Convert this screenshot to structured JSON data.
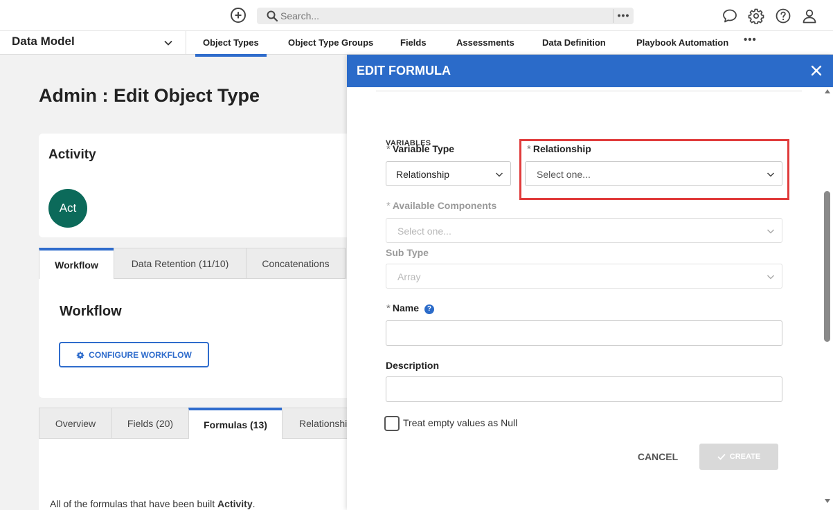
{
  "topbar": {
    "search_placeholder": "Search...",
    "search_more": "•••"
  },
  "nav": {
    "model": "Data Model",
    "tabs": [
      {
        "label": "Object Types",
        "active": true
      },
      {
        "label": "Object Type Groups"
      },
      {
        "label": "Fields"
      },
      {
        "label": "Assessments"
      },
      {
        "label": "Data Definition"
      },
      {
        "label": "Playbook Automation"
      }
    ],
    "more": "•••"
  },
  "page": {
    "title": "Admin : Edit Object Type",
    "object_name": "Activity",
    "avatar_text": "Act",
    "upper_tabs": [
      {
        "label": "Workflow",
        "active": true
      },
      {
        "label": "Data Retention (11/10)"
      },
      {
        "label": "Concatenations"
      }
    ],
    "workflow_title": "Workflow",
    "configure_button": "CONFIGURE WORKFLOW",
    "lower_tabs": [
      {
        "label": "Overview"
      },
      {
        "label": "Fields (20)"
      },
      {
        "label": "Formulas (13)",
        "active": true
      },
      {
        "label": "Relationshi"
      }
    ],
    "formulas_desc_prefix": "All of the formulas that have been built ",
    "formulas_desc_bold": "Activity",
    "formulas_desc_suffix": "."
  },
  "modal": {
    "title": "EDIT FORMULA",
    "section_heading": "VARIABLES",
    "required_mark": "*",
    "variable_type": {
      "label": "Variable Type",
      "value": "Relationship"
    },
    "relationship": {
      "label": "Relationship",
      "placeholder": "Select one..."
    },
    "available_components": {
      "label": "Available Components",
      "placeholder": "Select one..."
    },
    "sub_type": {
      "label": "Sub Type",
      "value": "Array"
    },
    "name": {
      "label": "Name",
      "help": "?",
      "value": ""
    },
    "description": {
      "label": "Description",
      "value": ""
    },
    "null_checkbox": {
      "label": "Treat empty values as Null",
      "checked": false
    },
    "cancel_button": "CANCEL",
    "create_button": "CREATE"
  },
  "colors": {
    "accent": "#2b6bc9",
    "highlight": "#e03b3b",
    "avatar": "#0c6a5a"
  }
}
